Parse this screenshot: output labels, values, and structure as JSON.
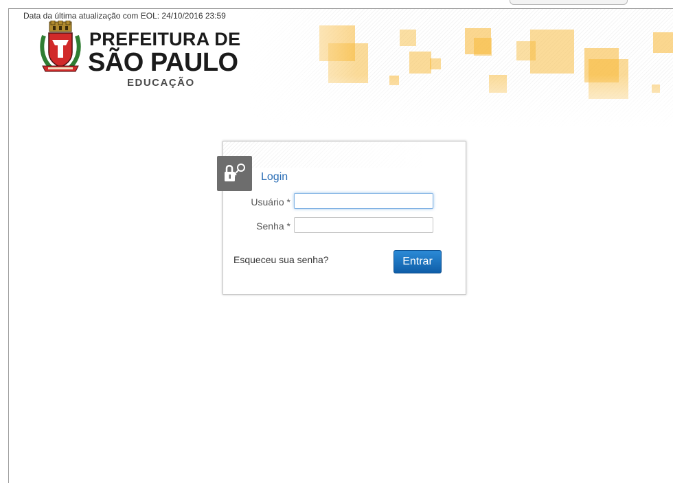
{
  "header": {
    "update_text": "Data da última atualização com EOL: 24/10/2016 23:59",
    "logo": {
      "line1": "PREFEITURA DE",
      "line2": "SÃO PAULO",
      "line3": "EDUCAÇÃO"
    }
  },
  "login": {
    "title": "Login",
    "username": {
      "label": "Usuário *",
      "value": "",
      "placeholder": ""
    },
    "password": {
      "label": "Senha *",
      "value": "",
      "placeholder": ""
    },
    "forgot_link": "Esqueceu sua senha?",
    "submit_label": "Entrar",
    "badge_icon": "lock-key-icon"
  },
  "colors": {
    "accent_blue": "#2a6db5",
    "button_blue": "#1570c2",
    "banner_orange": "#f7b733"
  }
}
